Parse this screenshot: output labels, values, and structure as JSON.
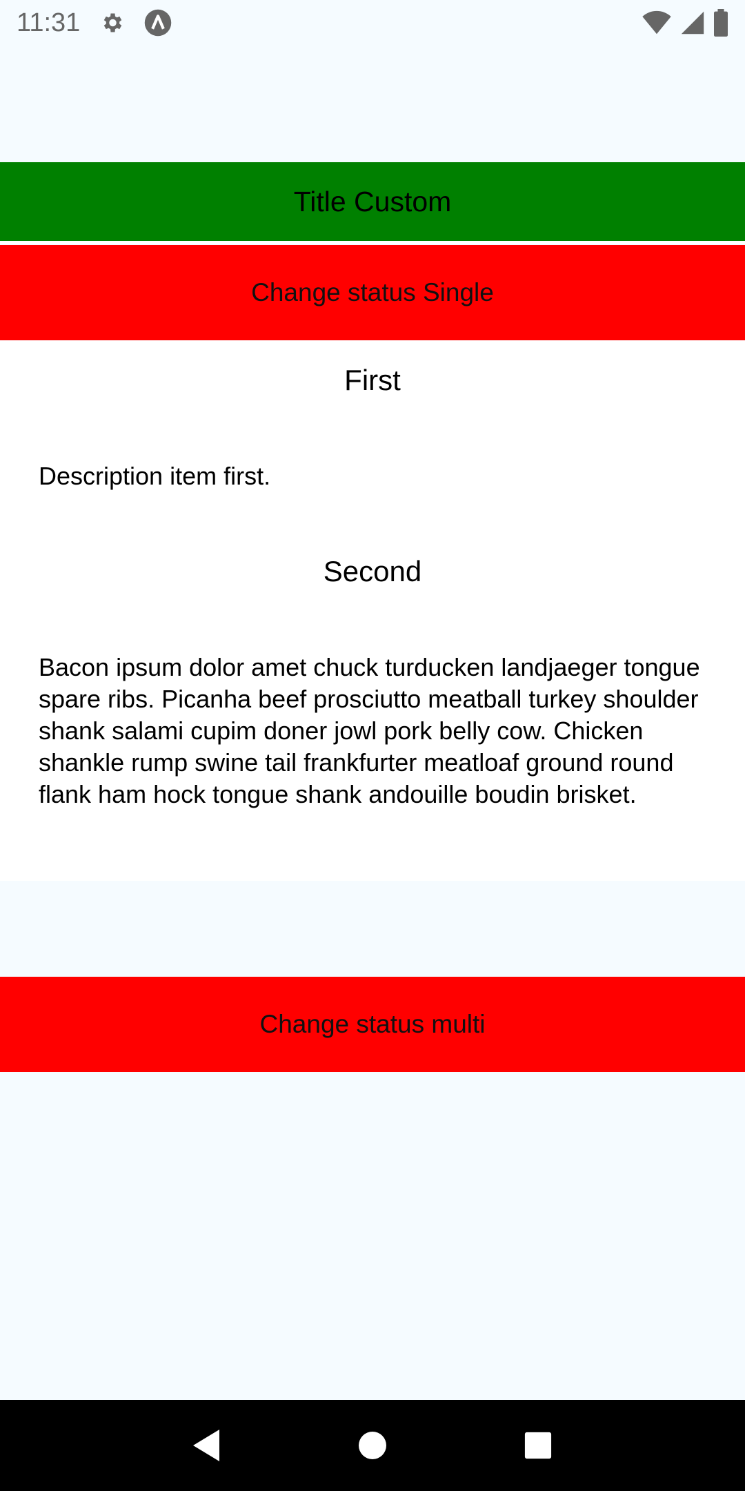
{
  "status_bar": {
    "time": "11:31",
    "icons": [
      "gear-icon",
      "a-badge-icon",
      "wifi-icon",
      "cell-signal-icon",
      "battery-icon"
    ]
  },
  "title_bar": {
    "title": "Title Custom",
    "background": "#008000"
  },
  "buttons": {
    "change_single": "Change status Single",
    "change_multi": "Change status multi",
    "background": "#ff0000"
  },
  "accordion": {
    "items": [
      {
        "title": "First",
        "body": "Description item first."
      },
      {
        "title": "Second",
        "body": "Bacon ipsum dolor amet chuck turducken landjaeger tongue spare ribs. Picanha beef prosciutto meatball turkey shoulder shank salami cupim doner jowl pork belly cow. Chicken shankle rump swine tail frankfurter meatloaf ground round flank ham hock tongue shank andouille boudin brisket."
      }
    ]
  },
  "nav_bar": {
    "icons": [
      "back-icon",
      "home-icon",
      "recents-icon"
    ]
  }
}
